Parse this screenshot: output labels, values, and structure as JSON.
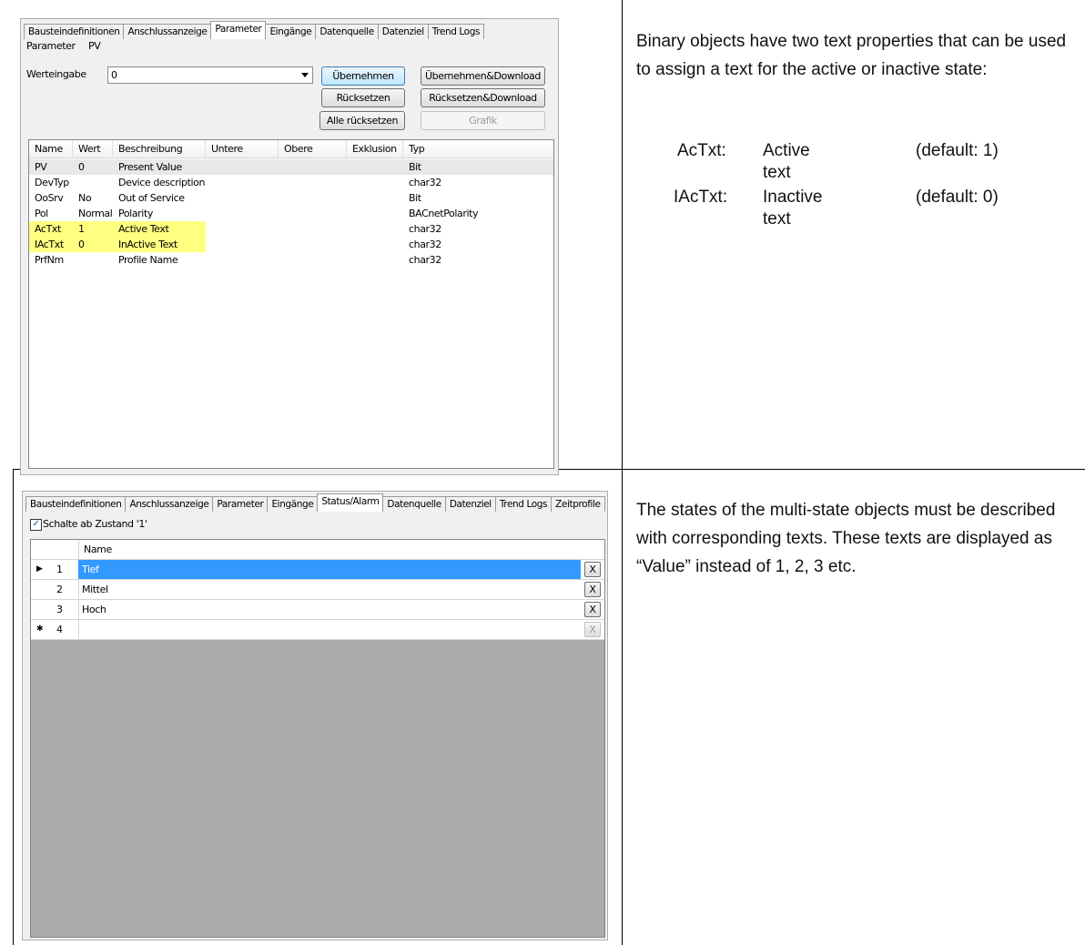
{
  "top_panel": {
    "tabs": [
      "Bausteindefinitionen",
      "Anschlussanzeige",
      "Parameter",
      "Eingänge",
      "Datenquelle",
      "Datenziel",
      "Trend Logs"
    ],
    "active_tab": "Parameter",
    "parameter_label": "Parameter",
    "parameter_value": "PV",
    "werteingabe_label": "Werteingabe",
    "werteingabe_value": "0",
    "buttons": {
      "uebernehmen": "Übernehmen",
      "ruecksetzen": "Rücksetzen",
      "alle_ruecksetzen": "Alle rücksetzen",
      "uebernehmen_download": "Übernehmen&Download",
      "ruecksetzen_download": "Rücksetzen&Download",
      "grafik": "Grafik"
    },
    "columns": [
      "Name",
      "Wert",
      "Beschreibung",
      "Untere Grenze",
      "Obere Grenze",
      "Exklusion",
      "Typ"
    ],
    "rows": [
      {
        "name": "PV",
        "wert": "0",
        "beschreibung": "Present Value",
        "typ": "Bit"
      },
      {
        "name": "DevTyp",
        "wert": "",
        "beschreibung": "Device description",
        "typ": "char32"
      },
      {
        "name": "OoSrv",
        "wert": "No",
        "beschreibung": "Out of Service",
        "typ": "Bit"
      },
      {
        "name": "Pol",
        "wert": "Normal",
        "beschreibung": "Polarity",
        "typ": "BACnetPolarity"
      },
      {
        "name": "AcTxt",
        "wert": "1",
        "beschreibung": "Active Text",
        "typ": "char32"
      },
      {
        "name": "IAcTxt",
        "wert": "0",
        "beschreibung": "InActive Text",
        "typ": "char32"
      },
      {
        "name": "PrfNm",
        "wert": "",
        "beschreibung": "Profile Name",
        "typ": "char32"
      }
    ],
    "highlight_color": "#ffff80"
  },
  "bottom_panel": {
    "tabs": [
      "Bausteindefinitionen",
      "Anschlussanzeige",
      "Parameter",
      "Eingänge",
      "Status/Alarm",
      "Datenquelle",
      "Datenziel",
      "Trend Logs",
      "Zeitprofile"
    ],
    "active_tab": "Status/Alarm",
    "checkbox_label": "Schalte ab Zustand '1'",
    "checkbox_checked": true,
    "name_header": "Name",
    "rows": [
      {
        "num": "1",
        "name": "Tief",
        "x": "X"
      },
      {
        "num": "2",
        "name": "Mittel",
        "x": "X"
      },
      {
        "num": "3",
        "name": "Hoch",
        "x": "X"
      },
      {
        "num": "4",
        "name": "",
        "x": "X"
      }
    ],
    "selected_color": "#3399ff"
  },
  "text": {
    "para1": "Binary objects have two text properties that can be used to assign a text for the active or inactive state:",
    "defs": [
      {
        "key": "AcTxt:",
        "desc": "Active text",
        "default": "(default: 1)"
      },
      {
        "key": "IAcTxt:",
        "desc": "Inactive text",
        "default": "(default: 0)"
      }
    ],
    "para2": "The states of the multi-state objects must be described with corresponding texts. These texts are displayed as “Value” instead of 1, 2, 3 etc."
  }
}
